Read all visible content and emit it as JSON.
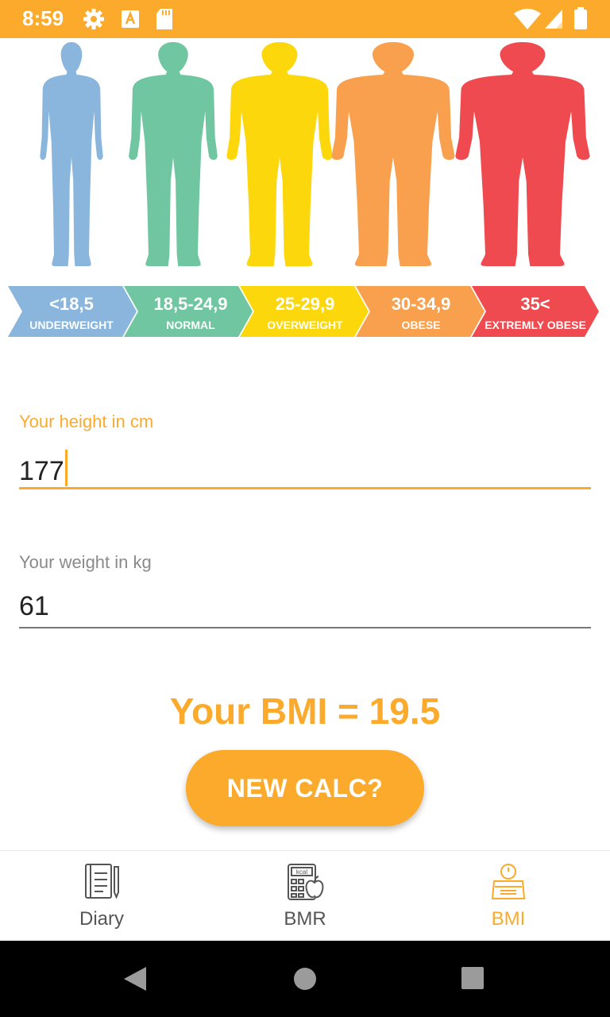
{
  "status_bar": {
    "time": "8:59",
    "icons": [
      "gear-icon",
      "a-icon",
      "sd-card-icon",
      "wifi-icon",
      "signal-icon",
      "battery-icon"
    ],
    "color": "#FBAA2C"
  },
  "hero": {
    "categories": [
      {
        "range": "<18,5",
        "name": "UNDERWEIGHT",
        "color": "#8AB6DD"
      },
      {
        "range": "18,5-24,9",
        "name": "NORMAL",
        "color": "#6FC6A1"
      },
      {
        "range": "25-29,9",
        "name": "OVERWEIGHT",
        "color": "#FBD70C"
      },
      {
        "range": "30-34,9",
        "name": "OBESE",
        "color": "#F8A04E"
      },
      {
        "range": "35<",
        "name": "EXTREMLY OBESE",
        "color": "#EE4A4F"
      }
    ]
  },
  "form": {
    "height": {
      "label": "Your height in cm",
      "value": "177"
    },
    "weight": {
      "label": "Your weight in kg",
      "value": "61"
    }
  },
  "result": {
    "text": "Your BMI = 19.5"
  },
  "actions": {
    "new_calc_label": "NEW CALC?"
  },
  "bottom_nav": {
    "items": [
      {
        "label": "Diary",
        "icon": "diary-icon",
        "active": false
      },
      {
        "label": "BMR",
        "icon": "calculator-icon",
        "active": false
      },
      {
        "label": "BMI",
        "icon": "scale-icon",
        "active": true
      }
    ],
    "active_color": "#FBAA2C",
    "inactive_color": "#555555"
  },
  "system_nav": {
    "icons": [
      "back-icon",
      "home-icon",
      "recents-icon"
    ]
  }
}
